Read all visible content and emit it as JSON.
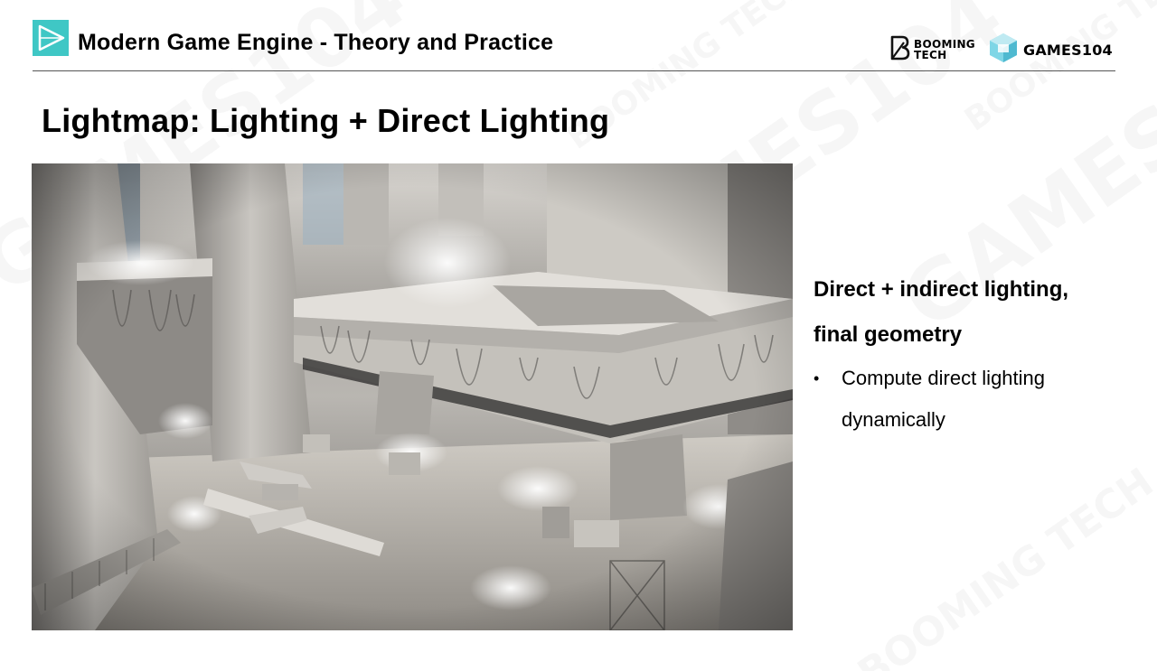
{
  "header": {
    "title": "Modern Game Engine - Theory and Practice",
    "booming_line1": "BOOMING",
    "booming_line2": "TECH",
    "games_label": "GAMES104"
  },
  "slide": {
    "title": "Lightmap: Lighting + Direct Lighting"
  },
  "content": {
    "heading_line1": "Direct + indirect lighting,",
    "heading_line2": "final geometry",
    "bullets": [
      "Compute direct lighting dynamically"
    ]
  },
  "watermark": {
    "text1": "GAMES104",
    "text2": "BOOMING TECH"
  },
  "colors": {
    "accent": "#3fc7c5",
    "divider": "#555555",
    "text": "#000000",
    "scene_base": "#7d7a75"
  },
  "icons": {
    "header_logo": "play-triangle-icon",
    "booming_logo": "booming-tech-logo-icon",
    "games_logo": "games104-cube-icon"
  }
}
